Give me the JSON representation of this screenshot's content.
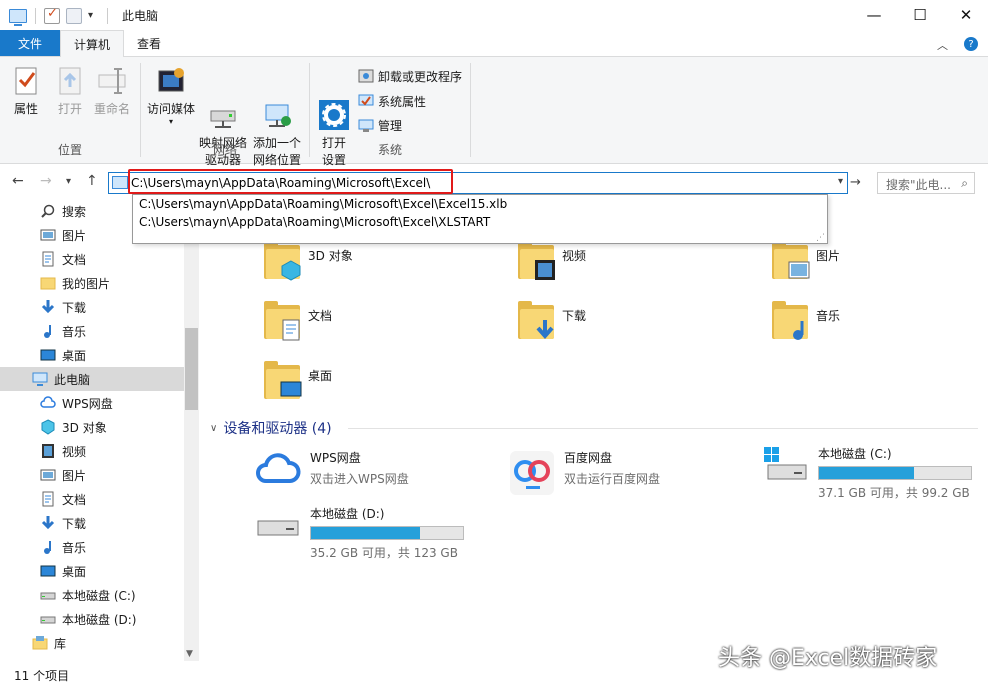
{
  "window": {
    "title": "此电脑"
  },
  "tabs": [
    {
      "label": "文件"
    },
    {
      "label": "计算机"
    },
    {
      "label": "查看"
    }
  ],
  "ribbon": {
    "location": {
      "label": "位置",
      "buttons": [
        "属性",
        "打开",
        "重命名"
      ]
    },
    "network": {
      "label": "网络",
      "buttons": [
        "访问媒体",
        "映射网络\n驱动器",
        "添加一个\n网络位置"
      ]
    },
    "system": {
      "label": "系统",
      "open_settings": "打开\n设置",
      "small": [
        "卸载或更改程序",
        "系统属性",
        "管理"
      ]
    }
  },
  "address": {
    "value": "C:\\Users\\mayn\\AppData\\Roaming\\Microsoft\\Excel\\",
    "suggestions": [
      "C:\\Users\\mayn\\AppData\\Roaming\\Microsoft\\Excel\\Excel15.xlb",
      "C:\\Users\\mayn\\AppData\\Roaming\\Microsoft\\Excel\\XLSTART"
    ]
  },
  "search": {
    "placeholder": "搜索\"此电..."
  },
  "sidebar": {
    "items": [
      {
        "label": "搜索",
        "icon": "search-icon"
      },
      {
        "label": "图片",
        "icon": "pictures-icon"
      },
      {
        "label": "文档",
        "icon": "documents-icon"
      },
      {
        "label": "我的图片",
        "icon": "folder-icon"
      },
      {
        "label": "下载",
        "icon": "download-icon"
      },
      {
        "label": "音乐",
        "icon": "music-icon"
      },
      {
        "label": "桌面",
        "icon": "desktop-icon"
      },
      {
        "label": "此电脑",
        "icon": "computer-icon"
      },
      {
        "label": "WPS网盘",
        "icon": "cloud-icon"
      },
      {
        "label": "3D 对象",
        "icon": "cube-icon"
      },
      {
        "label": "视频",
        "icon": "video-icon"
      },
      {
        "label": "图片",
        "icon": "pictures-icon"
      },
      {
        "label": "文档",
        "icon": "documents-icon"
      },
      {
        "label": "下载",
        "icon": "download-icon"
      },
      {
        "label": "音乐",
        "icon": "music-icon"
      },
      {
        "label": "桌面",
        "icon": "desktop-icon"
      },
      {
        "label": "本地磁盘 (C:)",
        "icon": "drive-icon"
      },
      {
        "label": "本地磁盘 (D:)",
        "icon": "drive-icon"
      },
      {
        "label": "库",
        "icon": "library-icon"
      }
    ]
  },
  "folders": [
    {
      "label": "3D 对象",
      "icon": "cube-icon"
    },
    {
      "label": "视频",
      "icon": "video-icon"
    },
    {
      "label": "图片",
      "icon": "pictures-icon"
    },
    {
      "label": "文档",
      "icon": "documents-icon"
    },
    {
      "label": "下载",
      "icon": "download-icon"
    },
    {
      "label": "音乐",
      "icon": "music-icon"
    },
    {
      "label": "桌面",
      "icon": "desktop-icon"
    }
  ],
  "devices": {
    "heading": "设备和驱动器 (4)",
    "items": [
      {
        "name": "WPS网盘",
        "sub": "双击进入WPS网盘",
        "icon": "wps-cloud-icon"
      },
      {
        "name": "百度网盘",
        "sub": "双击运行百度网盘",
        "icon": "baidu-cloud-icon"
      },
      {
        "name": "本地磁盘 (C:)",
        "sub": "37.1 GB 可用，共 99.2 GB",
        "icon": "windows-drive-icon",
        "used_fraction": 0.626
      },
      {
        "name": "本地磁盘 (D:)",
        "sub": "35.2 GB 可用，共 123 GB",
        "icon": "drive-icon",
        "used_fraction": 0.714
      }
    ]
  },
  "status": {
    "count": "11 个项目"
  },
  "watermark": "头条 @Excel数据砖家",
  "colors": {
    "accent": "#1979ca",
    "bar": "#26a0da",
    "highlight": "#e11a1a"
  }
}
